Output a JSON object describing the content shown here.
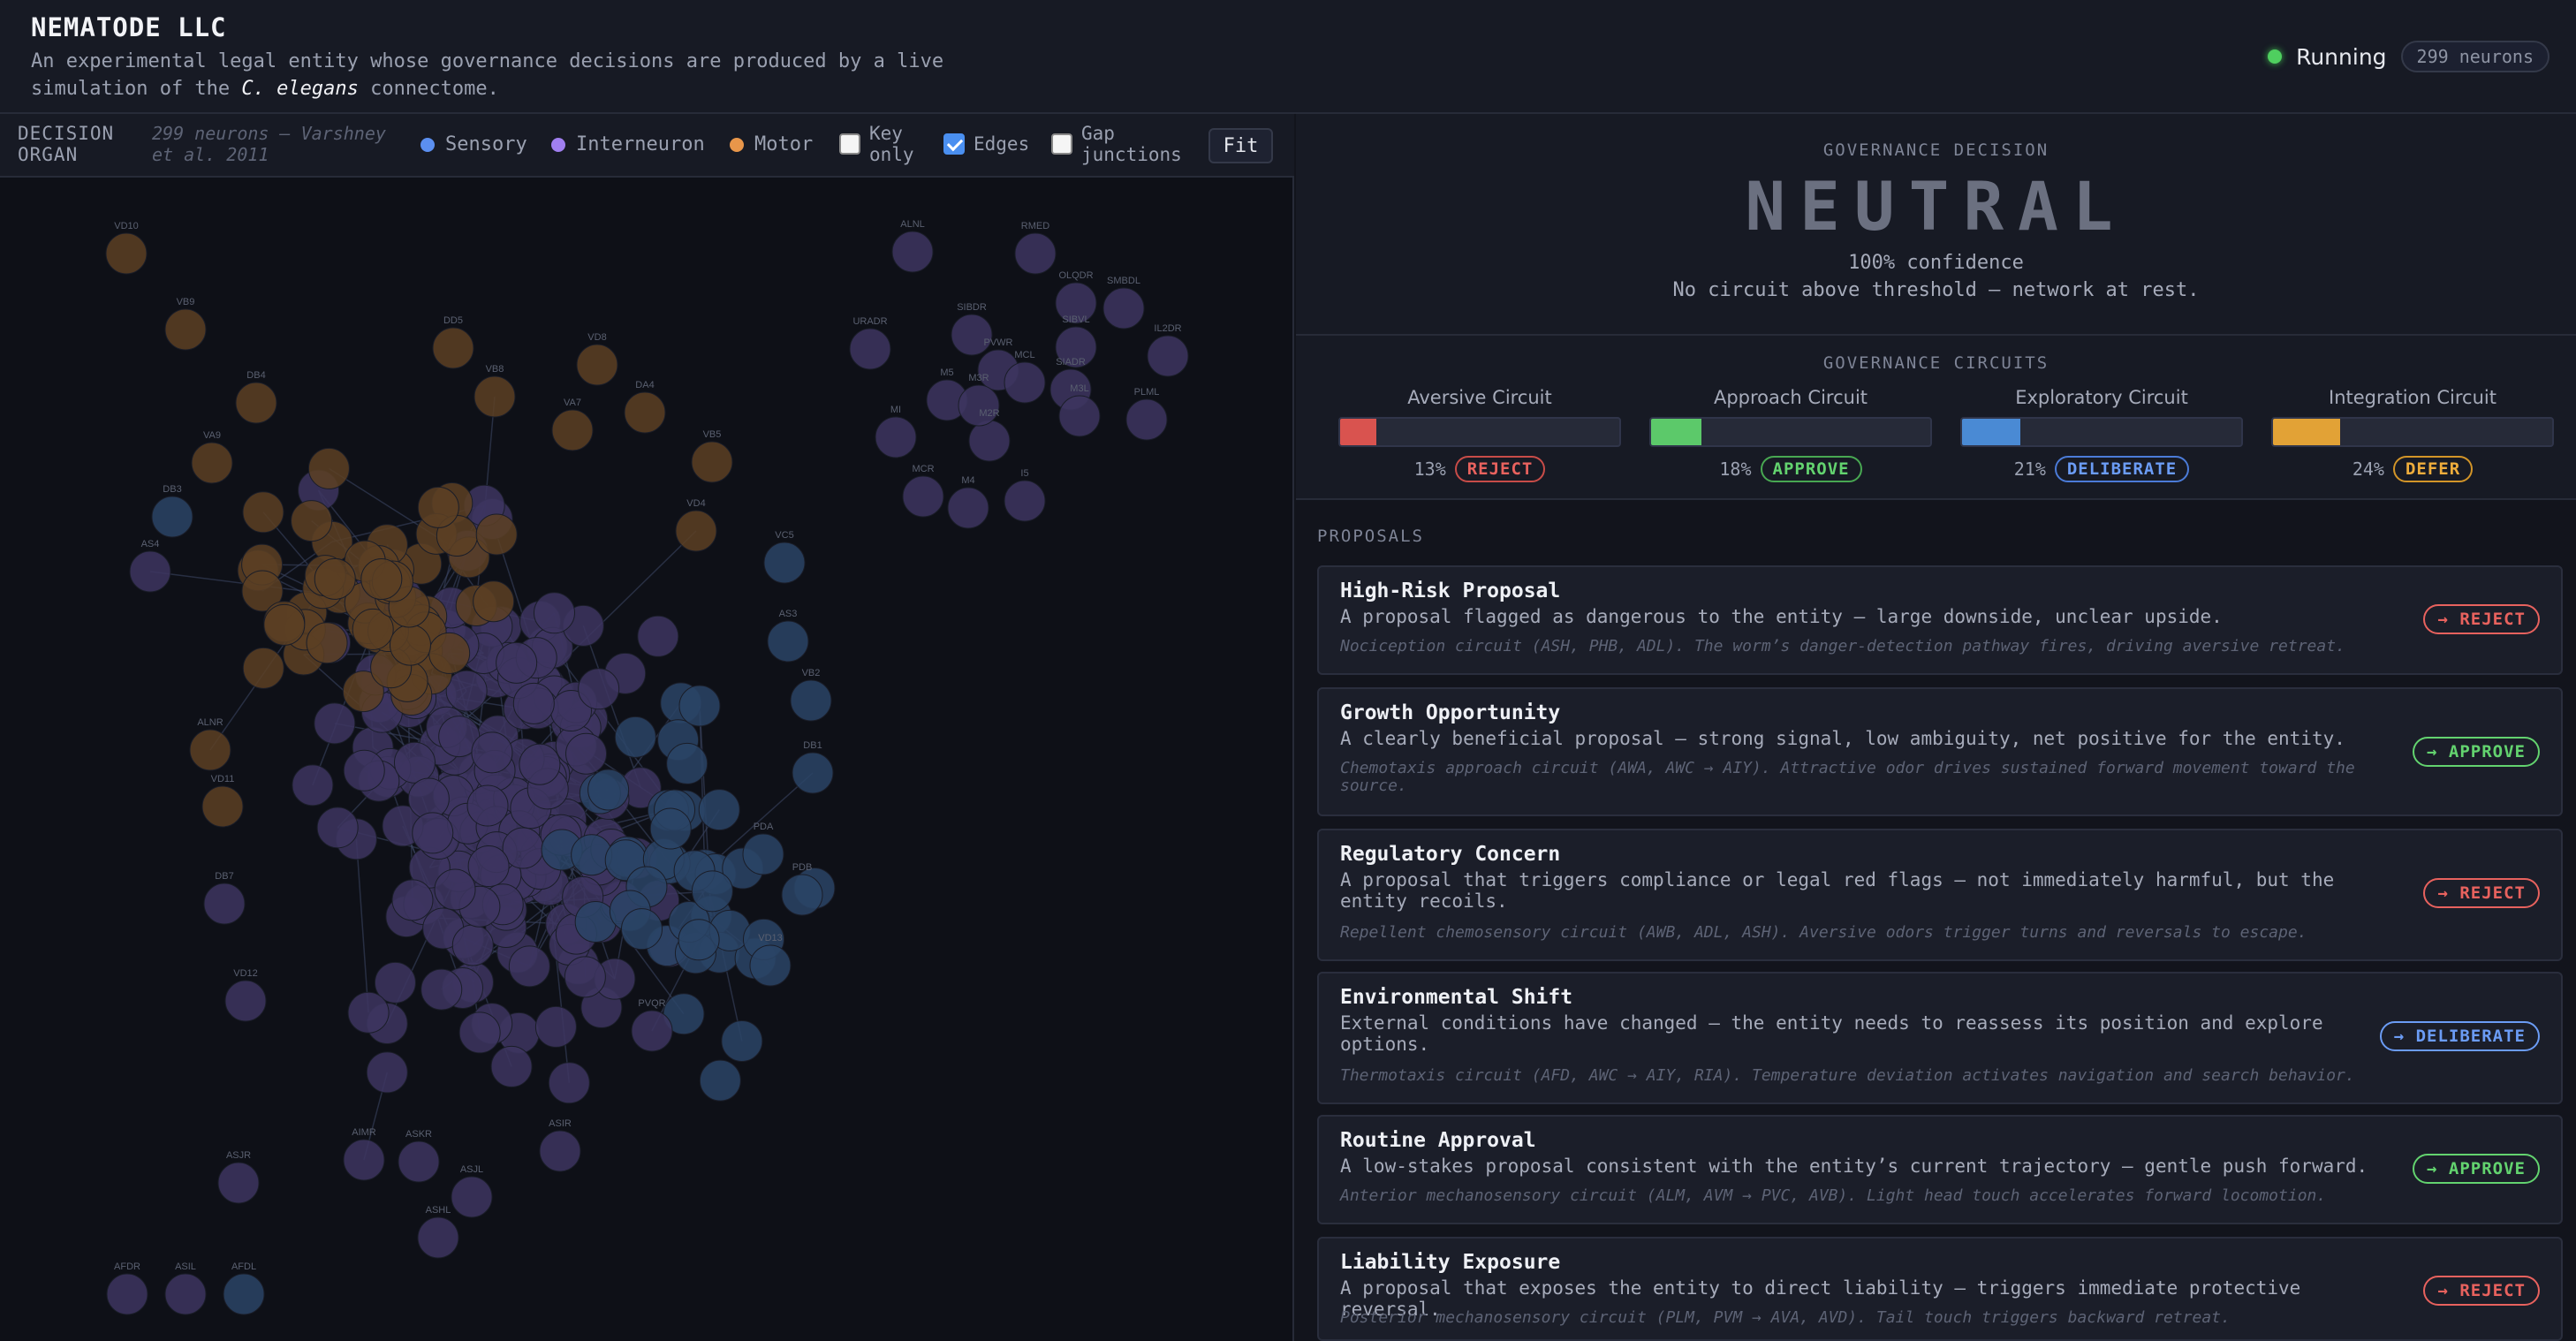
{
  "app": {
    "title": "NEMATODE LLC",
    "subtitle_pre": "An experimental legal entity whose governance decisions are produced by a live simulation of the ",
    "subtitle_em": "C. elegans",
    "subtitle_post": " connectome.",
    "status": "Running",
    "neuron_count": "299 neurons"
  },
  "toolbar": {
    "label": "DECISION ORGAN",
    "sublabel": "299 neurons — Varshney et al. 2011",
    "legend": [
      {
        "label": "Sensory",
        "color": "#5b8ff0"
      },
      {
        "label": "Interneuron",
        "color": "#a07ff0"
      },
      {
        "label": "Motor",
        "color": "#e8964a"
      }
    ],
    "checkboxes": [
      {
        "label": "Key only",
        "checked": false
      },
      {
        "label": "Edges",
        "checked": true
      },
      {
        "label": "Gap junctions",
        "checked": false
      }
    ],
    "fit_label": "Fit"
  },
  "graph": {
    "node_colors": {
      "sensory": "#2a4466",
      "inter": "#3d3560",
      "motor": "#5c3f23"
    },
    "labels": [
      "VD10",
      "VB9",
      "DD5",
      "VD8",
      "VB8",
      "DB4",
      "VA7",
      "DA4",
      "VB5",
      "VD4",
      "VA9",
      "DB3",
      "AS4",
      "VC5",
      "AS3",
      "VB2",
      "DB1",
      "PDA",
      "PDB",
      "VD13",
      "DB7",
      "VD12",
      "PVQR",
      "ASJR",
      "AIMR",
      "ASKR",
      "ASJL",
      "ASIR",
      "ASHL",
      "AFDR",
      "ASIL",
      "AFDL",
      "VD11",
      "ALNR",
      "ALNL",
      "RMED",
      "OLQDR",
      "SMBDL",
      "SIBVL",
      "SIBDR",
      "URADR",
      "IL2DR",
      "PVWR",
      "SIADR",
      "PLML",
      "M5",
      "MI",
      "M2R",
      "M3L",
      "MCR",
      "M4",
      "I5",
      "M3R",
      "MCL",
      "M1",
      "NSML",
      "I2L",
      "I1R",
      "MI2R"
    ]
  },
  "decision": {
    "heading": "GOVERNANCE DECISION",
    "value": "NEUTRAL",
    "confidence": "100% confidence",
    "note": "No circuit above threshold — network at rest."
  },
  "circuits": {
    "heading": "GOVERNANCE CIRCUITS",
    "items": [
      {
        "name": "Aversive Circuit",
        "pct": "13%",
        "level": 0.13,
        "color": "#d9534f",
        "badge": "REJECT",
        "kind": "reject"
      },
      {
        "name": "Approach Circuit",
        "pct": "18%",
        "level": 0.18,
        "color": "#5cc96a",
        "badge": "APPROVE",
        "kind": "approve"
      },
      {
        "name": "Exploratory Circuit",
        "pct": "21%",
        "level": 0.21,
        "color": "#4a8ad4",
        "badge": "DELIBERATE",
        "kind": "deliberate"
      },
      {
        "name": "Integration Circuit",
        "pct": "24%",
        "level": 0.24,
        "color": "#e2a236",
        "badge": "DEFER",
        "kind": "defer"
      }
    ]
  },
  "proposals": {
    "heading": "PROPOSALS",
    "items": [
      {
        "title": "High-Risk Proposal",
        "desc": "A proposal flagged as dangerous to the entity — large downside, unclear upside.",
        "note": "Nociception circuit (ASH, PHB, ADL). The worm’s danger-detection pathway fires, driving aversive retreat.",
        "action": "→ REJECT",
        "kind": "reject"
      },
      {
        "title": "Growth Opportunity",
        "desc": "A clearly beneficial proposal — strong signal, low ambiguity, net positive for the entity.",
        "note": "Chemotaxis approach circuit (AWA, AWC → AIY). Attractive odor drives sustained forward movement toward the source.",
        "action": "→ APPROVE",
        "kind": "approve"
      },
      {
        "title": "Regulatory Concern",
        "desc": "A proposal that triggers compliance or legal red flags — not immediately harmful, but the entity recoils.",
        "note": "Repellent chemosensory circuit (AWB, ADL, ASH). Aversive odors trigger turns and reversals to escape.",
        "action": "→ REJECT",
        "kind": "reject"
      },
      {
        "title": "Environmental Shift",
        "desc": "External conditions have changed — the entity needs to reassess its position and explore options.",
        "note": "Thermotaxis circuit (AFD, AWC → AIY, RIA). Temperature deviation activates navigation and search behavior.",
        "action": "→ DELIBERATE",
        "kind": "deliberate"
      },
      {
        "title": "Routine Approval",
        "desc": "A low-stakes proposal consistent with the entity’s current trajectory — gentle push forward.",
        "note": "Anterior mechanosensory circuit (ALM, AVM → PVC, AVB). Light head touch accelerates forward locomotion.",
        "action": "→ APPROVE",
        "kind": "approve"
      },
      {
        "title": "Liability Exposure",
        "desc": "A proposal that exposes the entity to direct liability — triggers immediate protective reversal.",
        "note": "Posterior mechanosensory circuit (PLM, PVM → AVA, AVD). Tail touch triggers backward retreat.",
        "action": "→ REJECT",
        "kind": "reject"
      }
    ]
  }
}
